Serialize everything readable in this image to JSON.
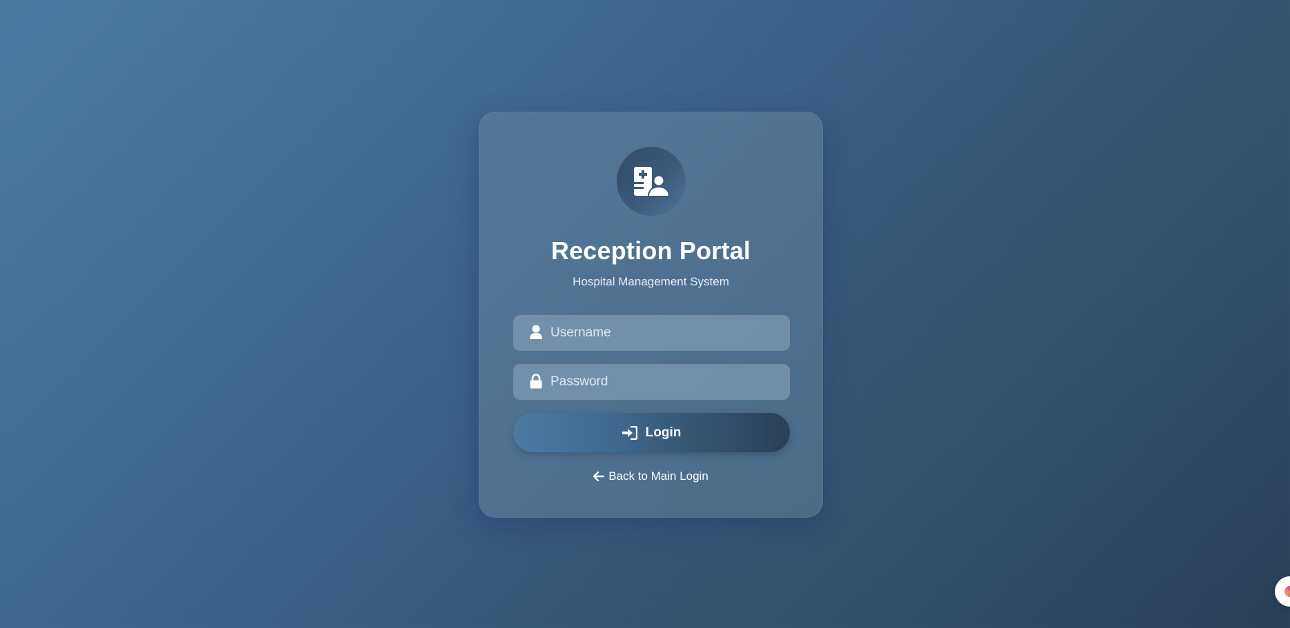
{
  "app": {
    "title": "Reception Portal",
    "subtitle": "Hospital Management System"
  },
  "logo": {
    "icon": "hospital-user-icon"
  },
  "form": {
    "username": {
      "placeholder": "Username",
      "value": "",
      "icon": "user-icon"
    },
    "password": {
      "placeholder": "Password",
      "value": "",
      "icon": "lock-icon"
    },
    "login_button": {
      "label": "Login",
      "icon": "sign-in-icon"
    },
    "back_link": {
      "label": "Back to Main Login",
      "icon": "arrow-left-icon"
    }
  },
  "colors": {
    "background_start": "#4a7aa3",
    "background_end": "#2b3f56",
    "text": "#ffffff"
  },
  "floating_widget": {
    "icon": "assistant-icon"
  }
}
